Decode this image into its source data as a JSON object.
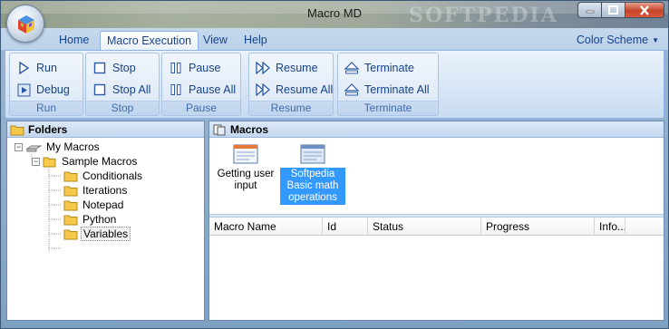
{
  "window": {
    "title": "Macro MD",
    "watermark": "SOFTPEDIA"
  },
  "tabs": [
    {
      "label": "Home",
      "active": false
    },
    {
      "label": "Macro Execution",
      "active": true
    },
    {
      "label": "View",
      "active": false
    },
    {
      "label": "Help",
      "active": false
    }
  ],
  "color_scheme": {
    "label": "Color Scheme"
  },
  "ribbon": {
    "run_group": {
      "label": "Run",
      "run": "Run",
      "debug": "Debug"
    },
    "stop_group": {
      "label": "Stop",
      "stop": "Stop",
      "stop_all": "Stop All"
    },
    "pause_group": {
      "label": "Pause",
      "pause": "Pause",
      "pause_all": "Pause All"
    },
    "resume_group": {
      "label": "Resume",
      "resume": "Resume",
      "resume_all": "Resume All"
    },
    "terminate_group": {
      "label": "Terminate",
      "terminate": "Terminate",
      "terminate_all": "Terminate All"
    }
  },
  "folders": {
    "title": "Folders",
    "root": "My Macros",
    "sample": "Sample Macros",
    "children": [
      "Conditionals",
      "Iterations",
      "Notepad",
      "Python",
      "Variables"
    ],
    "selected": "Variables"
  },
  "macros": {
    "title": "Macros",
    "items": [
      {
        "label": "Getting user input",
        "selected": false
      },
      {
        "label": "Softpedia Basic math operations",
        "selected": true
      }
    ]
  },
  "grid": {
    "columns": [
      "Macro Name",
      "Id",
      "Status",
      "Progress",
      "Info..."
    ]
  },
  "colors": {
    "accent": "#15428b",
    "selection": "#3399ff",
    "ribbon_border": "#8db2e3"
  }
}
